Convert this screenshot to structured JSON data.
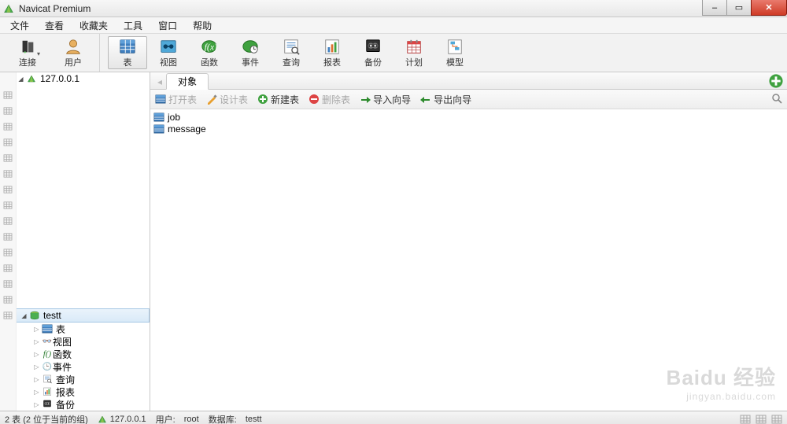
{
  "window": {
    "title": "Navicat Premium",
    "controls": {
      "minimize": "–",
      "maximize": "▭",
      "close": "✕"
    }
  },
  "menu": [
    "文件",
    "查看",
    "收藏夹",
    "工具",
    "窗口",
    "帮助"
  ],
  "toolbar": {
    "connect": "连接",
    "user": "用户",
    "table": "表",
    "view": "视图",
    "function": "函数",
    "event": "事件",
    "query": "查询",
    "report": "报表",
    "backup": "备份",
    "schedule": "计划",
    "model": "模型"
  },
  "sidebar": {
    "connection": "127.0.0.1",
    "database": "testt",
    "nodes": [
      {
        "label": "表",
        "icon": "table"
      },
      {
        "label": "视图",
        "icon": "view"
      },
      {
        "label": "函数",
        "icon": "function"
      },
      {
        "label": "事件",
        "icon": "event"
      },
      {
        "label": "查询",
        "icon": "query"
      },
      {
        "label": "报表",
        "icon": "report"
      },
      {
        "label": "备份",
        "icon": "backup"
      }
    ]
  },
  "tabs": {
    "active": "对象",
    "new_icon": "+"
  },
  "actions": {
    "open": "打开表",
    "design": "设计表",
    "new": "新建表",
    "delete": "删除表",
    "import": "导入向导",
    "export": "导出向导"
  },
  "tables": [
    "job",
    "message"
  ],
  "status": {
    "left": "2 表 (2 位于当前的组)",
    "host": "127.0.0.1",
    "user_label": "用户:",
    "user": "root",
    "db_label": "数据库:",
    "db": "testt"
  },
  "watermark": {
    "line1": "Baidu 经验",
    "line2": "jingyan.baidu.com"
  }
}
